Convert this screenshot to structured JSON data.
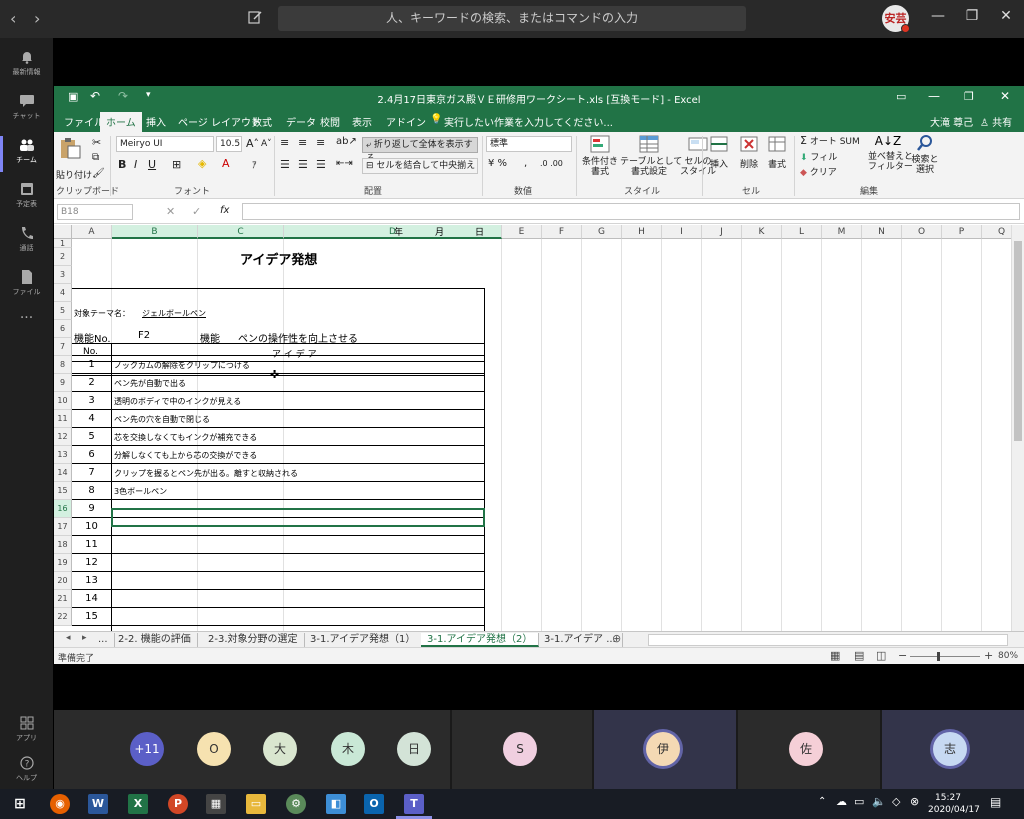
{
  "teams": {
    "search_placeholder": "人、キーワードの検索、またはコマンドの入力",
    "avatar_label": "安芸",
    "rail": [
      {
        "label": "最新情報",
        "icon": "bell-icon"
      },
      {
        "label": "チャット",
        "icon": "chat-icon"
      },
      {
        "label": "チーム",
        "icon": "teams-icon"
      },
      {
        "label": "予定表",
        "icon": "calendar-icon"
      },
      {
        "label": "通話",
        "icon": "phone-icon"
      },
      {
        "label": "ファイル",
        "icon": "file-icon"
      },
      {
        "label": "···",
        "icon": "more-icon"
      }
    ],
    "rail_bottom": [
      {
        "label": "アプリ",
        "icon": "apps-icon"
      },
      {
        "label": "ヘルプ",
        "icon": "help-icon"
      }
    ]
  },
  "excel": {
    "title": "2.4月17日東京ガス殿ＶＥ研修用ワークシート.xls  [互換モード] - Excel",
    "user": "大滝 尊己",
    "share": "共有",
    "tabs": [
      "ファイル",
      "ホーム",
      "挿入",
      "ページ レイアウト",
      "数式",
      "データ",
      "校閲",
      "表示",
      "アドイン"
    ],
    "tell_me": "実行したい作業を入力してください...",
    "ribbon": {
      "paste": "貼り付け",
      "font_name": "Meiryo UI",
      "font_size": "10.5",
      "wrap_text": "折り返して全体を表示する",
      "merge_center": "セルを結合して中央揃え",
      "number_format": "標準",
      "cond_format": "条件付き\n書式",
      "table_format": "テーブルとして\n書式設定",
      "cell_styles": "セルの\nスタイル",
      "insert": "挿入",
      "delete": "削除",
      "format": "書式",
      "autosum": "オート SUM",
      "fill": "フィル",
      "clear": "クリア",
      "sort_filter": "並べ替えと\nフィルター",
      "find_select": "検索と\n選択",
      "groups": [
        "クリップボード",
        "フォント",
        "配置",
        "数値",
        "スタイル",
        "セル",
        "編集"
      ]
    },
    "name_box": "B18",
    "fx": "fx",
    "columns": [
      "A",
      "B",
      "C",
      "D",
      "E",
      "F",
      "G",
      "H",
      "I",
      "J",
      "K",
      "L",
      "M",
      "N",
      "O",
      "P",
      "Q"
    ],
    "rows": [
      "1",
      "2",
      "3",
      "4",
      "5",
      "6",
      "7",
      "8",
      "9",
      "10",
      "11",
      "12",
      "13",
      "14",
      "15",
      "16",
      "17",
      "18",
      "19",
      "20",
      "21",
      "22"
    ],
    "sheet": {
      "date_year": "年",
      "date_month": "月",
      "date_day": "日",
      "heading": "アイデア発想",
      "theme_label": "対象テーマ名：",
      "theme_value": "ジェルボールペン",
      "func_no_label": "機能No.",
      "func_no": "F2",
      "func_label": "機能",
      "func_value": "ペンの操作性を向上させる",
      "col_no": "No.",
      "col_idea": "ア イ デ ア",
      "ideas": [
        {
          "no": "1",
          "text": "ノックカムの解除をクリップにつける"
        },
        {
          "no": "2",
          "text": "ペン先が自動で出る"
        },
        {
          "no": "3",
          "text": "透明のボディで中のインクが見える"
        },
        {
          "no": "4",
          "text": "ペン先の穴を自動で閉じる"
        },
        {
          "no": "5",
          "text": "芯を交換しなくてもインクが補充できる"
        },
        {
          "no": "6",
          "text": "分解しなくても上から芯の交換ができる"
        },
        {
          "no": "7",
          "text": "クリップを握るとペン先が出る。離すと収納される"
        },
        {
          "no": "8",
          "text": "3色ボールペン"
        },
        {
          "no": "9",
          "text": ""
        },
        {
          "no": "10",
          "text": ""
        },
        {
          "no": "11",
          "text": ""
        },
        {
          "no": "12",
          "text": ""
        },
        {
          "no": "13",
          "text": ""
        },
        {
          "no": "14",
          "text": ""
        },
        {
          "no": "15",
          "text": ""
        }
      ]
    },
    "sheet_tabs": [
      "...",
      "2-2. 機能の評価",
      "2-3.対象分野の選定",
      "3-1.アイデア発想（1）",
      "3-1.アイデア発想（2）",
      "3-1.アイデア ..."
    ],
    "status": "準備完了",
    "zoom": "80%"
  },
  "meeting": {
    "participants": [
      {
        "initial": "+11",
        "color": "#5b5fc7"
      },
      {
        "initial": "O",
        "color": "#f6e2b0"
      },
      {
        "initial": "大",
        "color": "#d9e6cf"
      },
      {
        "initial": "木",
        "color": "#c9e8d6"
      },
      {
        "initial": "日",
        "color": "#d3e3d7"
      },
      {
        "initial": "S",
        "color": "#f0cfe0"
      },
      {
        "initial": "伊",
        "color": "#f4d9b4"
      },
      {
        "initial": "佐",
        "color": "#f5cfd7"
      },
      {
        "initial": "志",
        "color": "#c7d9f2"
      }
    ]
  },
  "taskbar": {
    "time": "15:27",
    "date": "2020/04/17"
  }
}
